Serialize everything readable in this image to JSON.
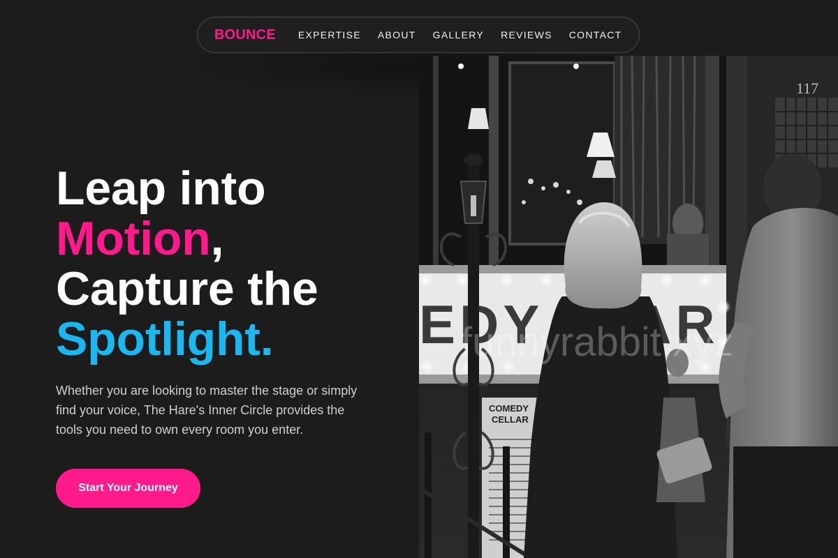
{
  "nav": {
    "logo": "BOUNCE",
    "links": [
      "EXPERTISE",
      "ABOUT",
      "GALLERY",
      "REVIEWS",
      "CONTACT"
    ]
  },
  "hero": {
    "line1": "Leap into",
    "line2_highlight": "Motion",
    "line2_suffix": ",",
    "line3": "Capture the",
    "line4_highlight": "Spotlight.",
    "subtext": "Whether you are looking to master the stage or simply find your voice, The Hare's Inner Circle provides the tools you need to own every room you enter.",
    "cta_label": "Start Your Journey"
  },
  "photo": {
    "alt": "Black and white photo of people outside a comedy club marquee",
    "watermark": "funnyrabbit.xyz",
    "door_number": "117",
    "sign_top": "COMEDY",
    "sign_bottom": "CELLAR"
  },
  "colors": {
    "background": "#1c1c1c",
    "accent_pink": "#ff1a8c",
    "accent_blue": "#1ab8f0",
    "text_primary": "#ffffff",
    "text_secondary": "#cfcfcf"
  }
}
